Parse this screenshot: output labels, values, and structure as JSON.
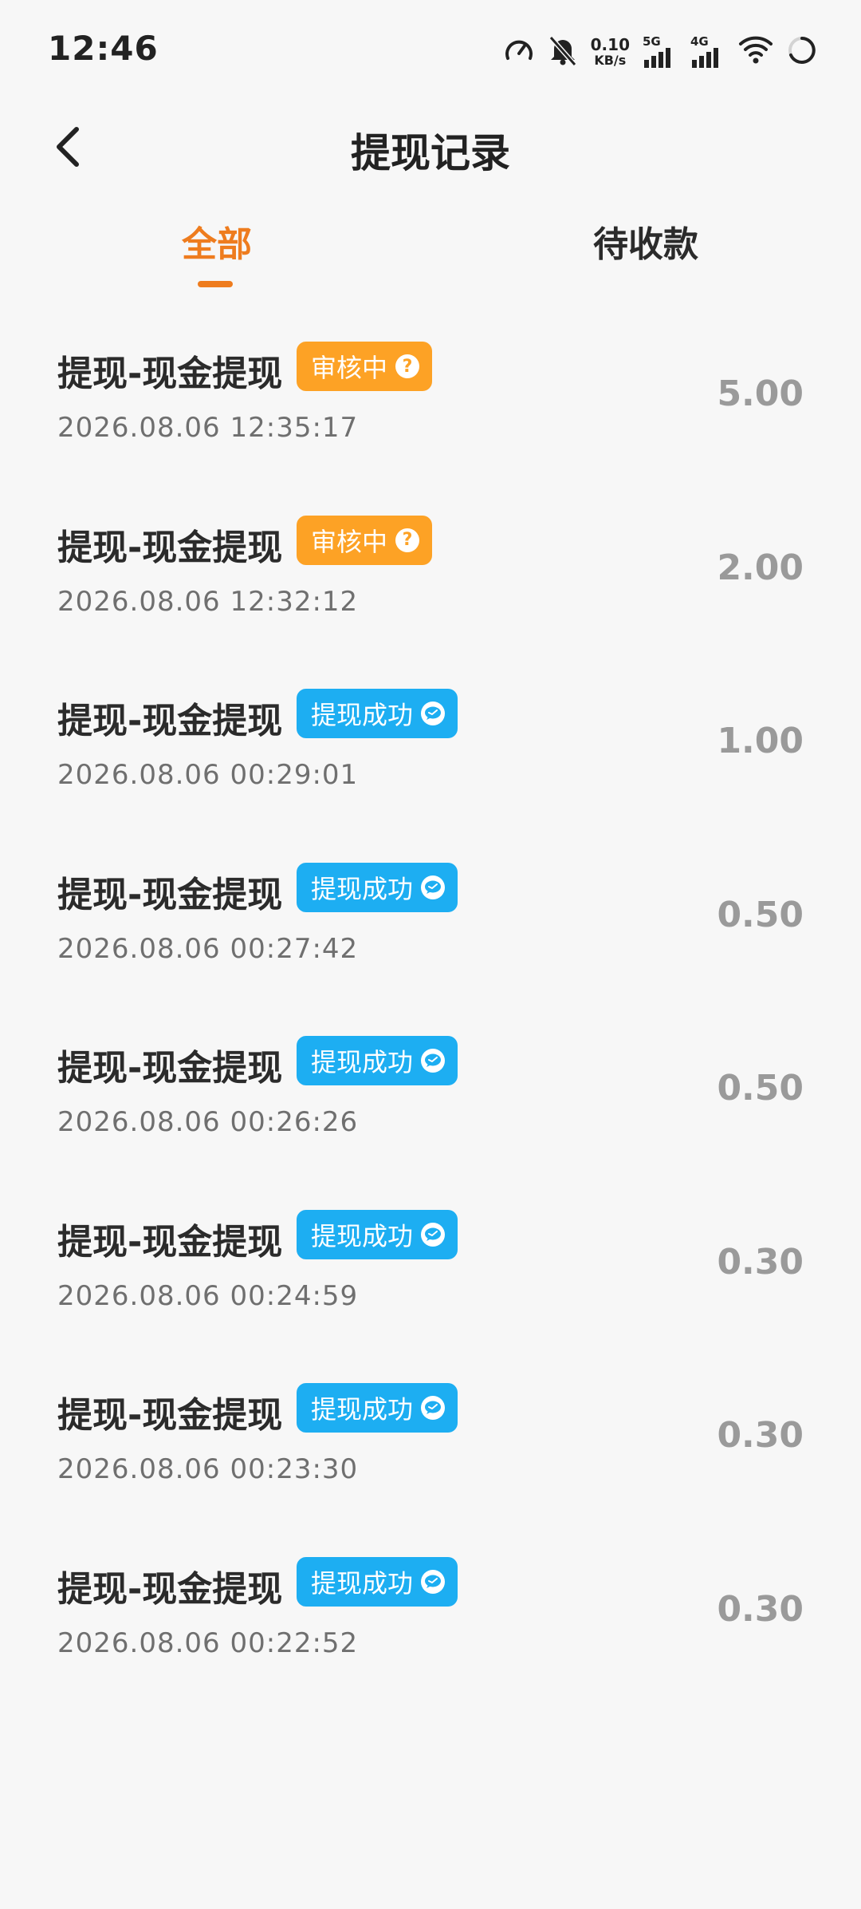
{
  "status_bar": {
    "time": "12:46",
    "net_speed_value": "0.10",
    "net_speed_unit": "KB/s",
    "sim1_label": "5G",
    "sim2_label": "4G"
  },
  "header": {
    "title": "提现记录"
  },
  "tabs": [
    {
      "label": "全部",
      "active": true
    },
    {
      "label": "待收款",
      "active": false
    }
  ],
  "colors": {
    "accent": "#ee7c1e",
    "pending_badge": "#fda225",
    "success_badge": "#1daef2",
    "amount": "#9a9a9a"
  },
  "records": [
    {
      "title": "提现-现金提现",
      "status": "审核中",
      "status_icon": "question-icon",
      "time": "2026.08.06 12:35:17",
      "amount": "5.00"
    },
    {
      "title": "提现-现金提现",
      "status": "审核中",
      "status_icon": "question-icon",
      "time": "2026.08.06 12:32:12",
      "amount": "2.00"
    },
    {
      "title": "提现-现金提现",
      "status": "提现成功",
      "status_icon": "wechat-icon",
      "time": "2026.08.06 00:29:01",
      "amount": "1.00"
    },
    {
      "title": "提现-现金提现",
      "status": "提现成功",
      "status_icon": "wechat-icon",
      "time": "2026.08.06 00:27:42",
      "amount": "0.50"
    },
    {
      "title": "提现-现金提现",
      "status": "提现成功",
      "status_icon": "wechat-icon",
      "time": "2026.08.06 00:26:26",
      "amount": "0.50"
    },
    {
      "title": "提现-现金提现",
      "status": "提现成功",
      "status_icon": "wechat-icon",
      "time": "2026.08.06 00:24:59",
      "amount": "0.30"
    },
    {
      "title": "提现-现金提现",
      "status": "提现成功",
      "status_icon": "wechat-icon",
      "time": "2026.08.06 00:23:30",
      "amount": "0.30"
    },
    {
      "title": "提现-现金提现",
      "status": "提现成功",
      "status_icon": "wechat-icon",
      "time": "2026.08.06 00:22:52",
      "amount": "0.30"
    }
  ]
}
